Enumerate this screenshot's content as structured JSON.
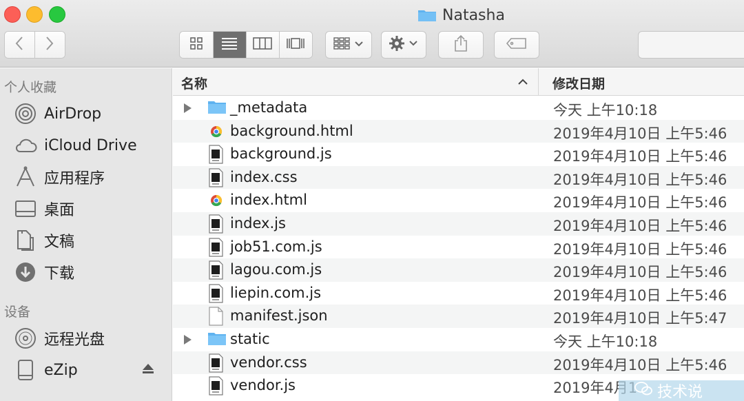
{
  "window": {
    "title": "Natasha"
  },
  "toolbar": {
    "back_icon": "chevron-left-icon",
    "forward_icon": "chevron-right-icon",
    "views": [
      {
        "icon": "icon-view-icon",
        "active": false
      },
      {
        "icon": "list-view-icon",
        "active": true
      },
      {
        "icon": "column-view-icon",
        "active": false
      },
      {
        "icon": "gallery-view-icon",
        "active": false
      }
    ],
    "arrange_icon": "group-by-icon",
    "action_icon": "gear-icon",
    "share_icon": "share-icon",
    "tag_icon": "tag-icon"
  },
  "sidebar": {
    "sections": [
      {
        "title": "个人收藏",
        "items": [
          {
            "label": "AirDrop",
            "icon": "airdrop-icon"
          },
          {
            "label": "iCloud Drive",
            "icon": "cloud-icon"
          },
          {
            "label": "应用程序",
            "icon": "applications-icon"
          },
          {
            "label": "桌面",
            "icon": "desktop-icon"
          },
          {
            "label": "文稿",
            "icon": "documents-icon"
          },
          {
            "label": "下载",
            "icon": "downloads-icon"
          }
        ]
      },
      {
        "title": "设备",
        "items": [
          {
            "label": "远程光盘",
            "icon": "disc-icon"
          },
          {
            "label": "eZip",
            "icon": "drive-icon"
          }
        ]
      }
    ]
  },
  "list": {
    "columns": {
      "name": "名称",
      "date": "修改日期"
    },
    "rows": [
      {
        "name": "_metadata",
        "date": "今天 上午10:18",
        "type": "folder"
      },
      {
        "name": "background.html",
        "date": "2019年4月10日 上午5:46",
        "type": "html"
      },
      {
        "name": "background.js",
        "date": "2019年4月10日 上午5:46",
        "type": "script"
      },
      {
        "name": "index.css",
        "date": "2019年4月10日 上午5:46",
        "type": "script"
      },
      {
        "name": "index.html",
        "date": "2019年4月10日 上午5:46",
        "type": "html"
      },
      {
        "name": "index.js",
        "date": "2019年4月10日 上午5:46",
        "type": "script"
      },
      {
        "name": "job51.com.js",
        "date": "2019年4月10日 上午5:46",
        "type": "script"
      },
      {
        "name": "lagou.com.js",
        "date": "2019年4月10日 上午5:46",
        "type": "script"
      },
      {
        "name": "liepin.com.js",
        "date": "2019年4月10日 上午5:46",
        "type": "script"
      },
      {
        "name": "manifest.json",
        "date": "2019年4月10日 上午5:47",
        "type": "document"
      },
      {
        "name": "static",
        "date": "今天 上午10:18",
        "type": "folder"
      },
      {
        "name": "vendor.css",
        "date": "2019年4月10日 上午5:46",
        "type": "script"
      },
      {
        "name": "vendor.js",
        "date": "2019年4月1",
        "type": "script"
      }
    ]
  },
  "watermark": {
    "text": "技术说"
  }
}
